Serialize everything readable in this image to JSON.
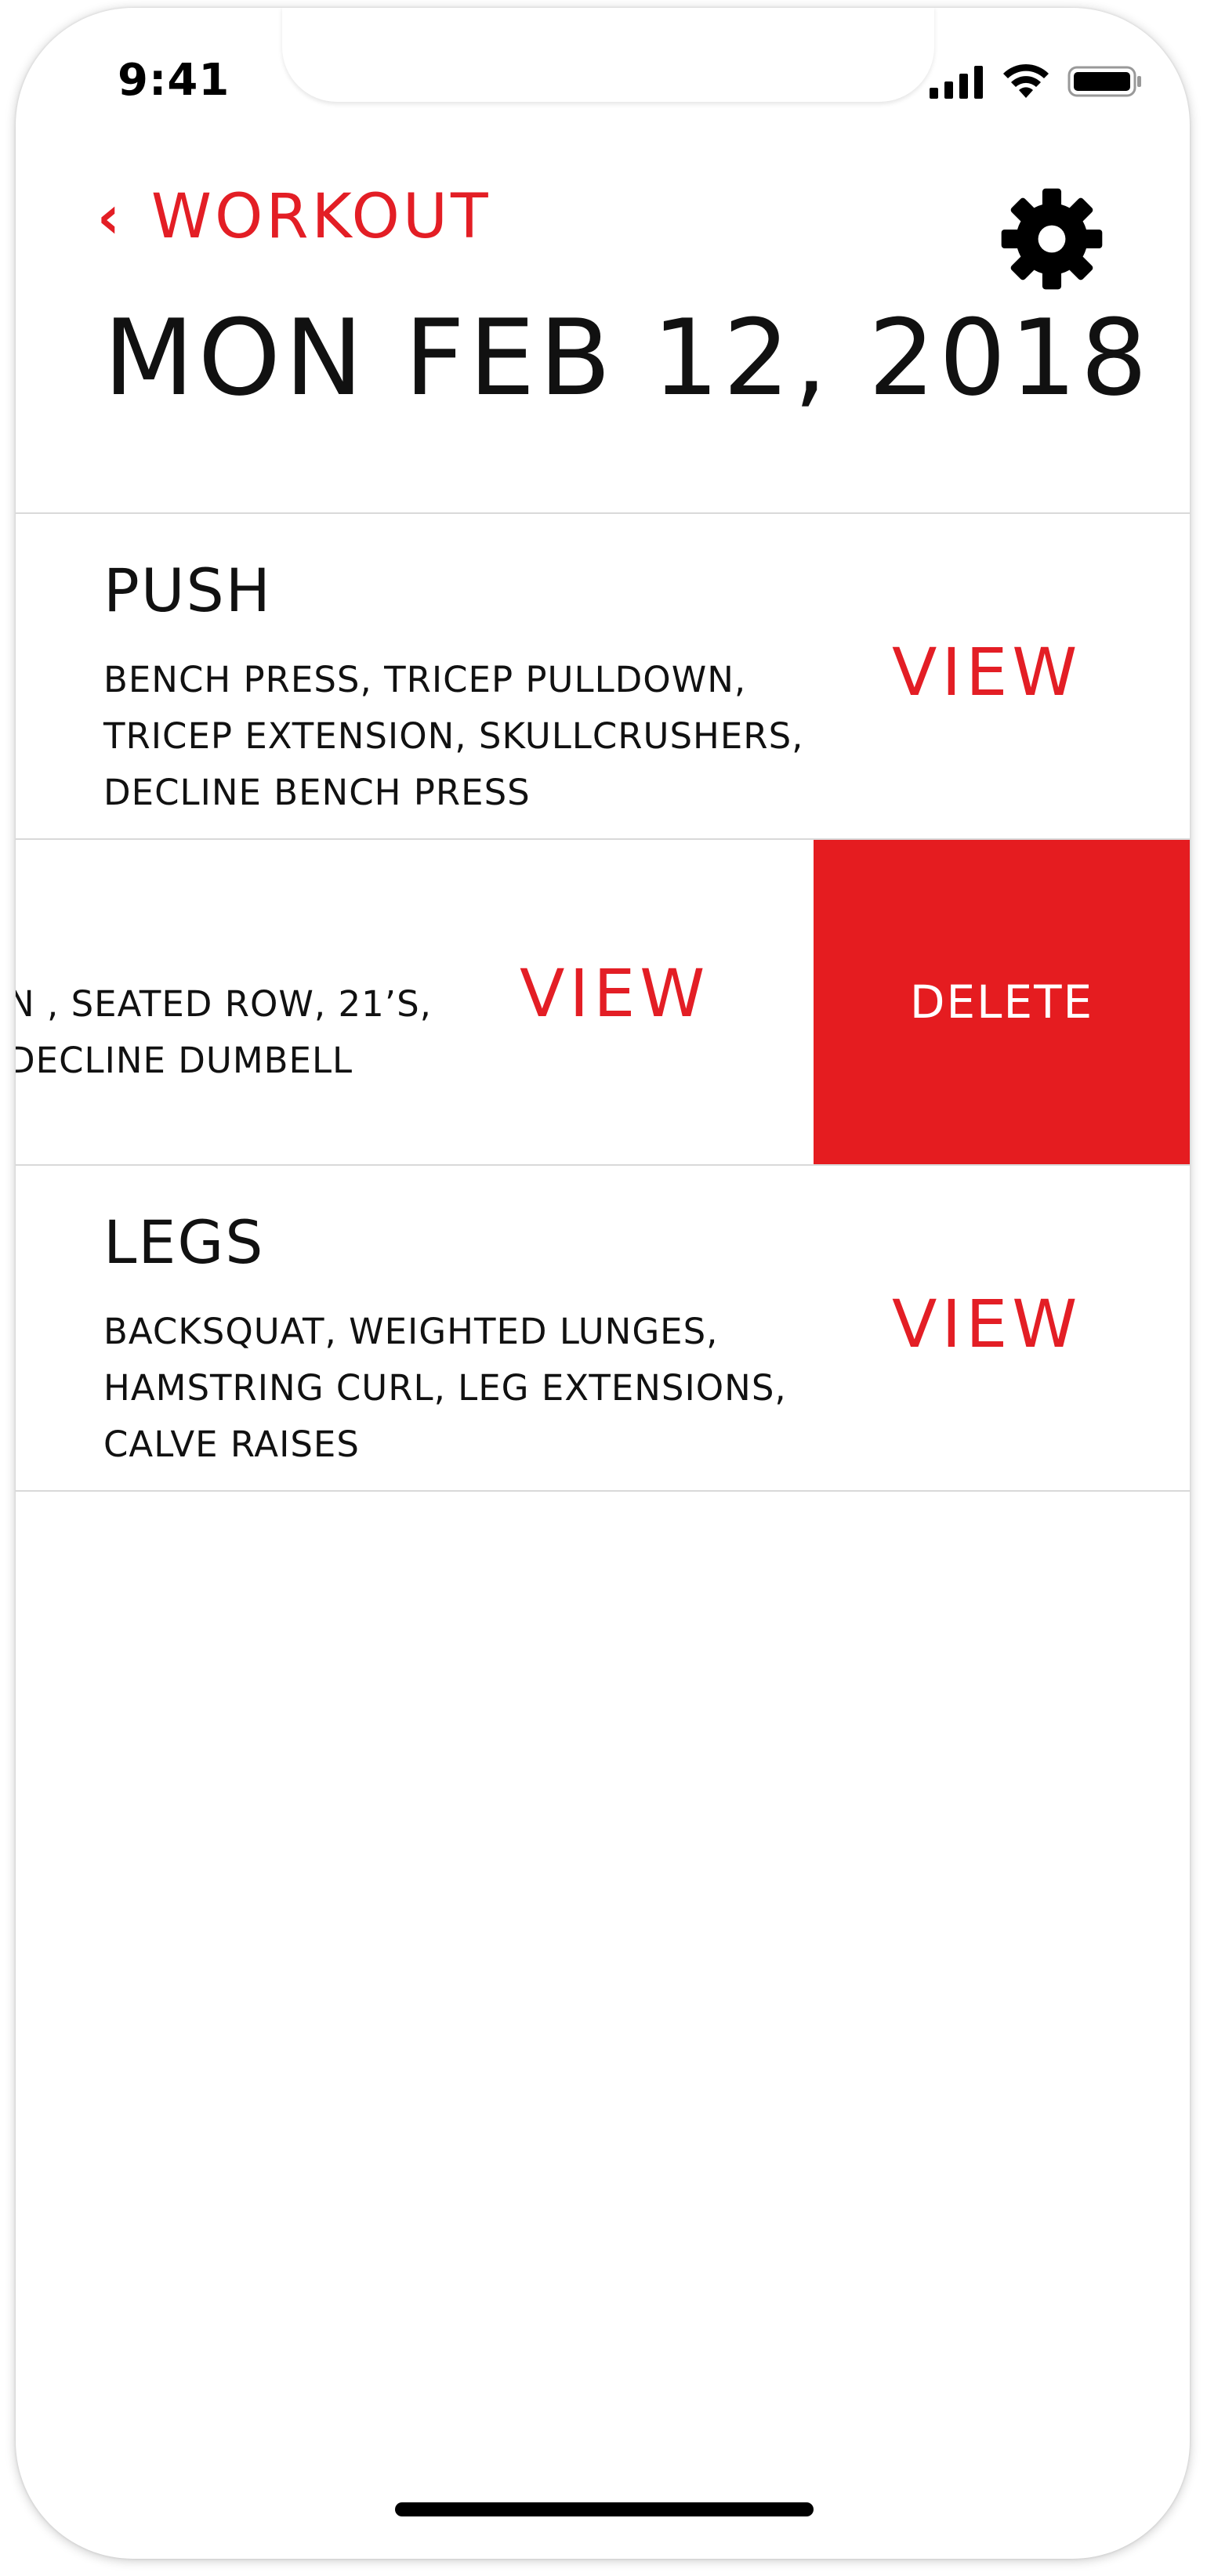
{
  "status_bar": {
    "time": "9:41",
    "signal_icon": "cellular-signal-icon",
    "wifi_icon": "wifi-icon",
    "battery_icon": "battery-icon"
  },
  "header": {
    "back_icon": "chevron-left-icon",
    "back_label": "WORKOUT",
    "settings_icon": "gear-icon",
    "title": "MON FEB 12, 2018"
  },
  "colors": {
    "accent": "#e31e25",
    "delete_bg": "#e51c20",
    "text": "#111111"
  },
  "workouts": [
    {
      "name": "PUSH",
      "exercises_lines": [
        "BENCH PRESS, TRICEP PULLDOWN,",
        "TRICEP EXTENSION, SKULLCRUSHERS,",
        "DECLINE BENCH PRESS"
      ],
      "view_label": "VIEW"
    },
    {
      "name": "",
      "exercises_lines": [
        "N ,  SEATED ROW, 21’S,",
        "  DECLINE DUMBELL"
      ],
      "view_label": "VIEW",
      "delete_label": "DELETE",
      "swiped": true
    },
    {
      "name": "LEGS",
      "exercises_lines": [
        "BACKSQUAT, WEIGHTED LUNGES,",
        "HAMSTRING CURL, LEG EXTENSIONS,",
        "CALVE RAISES"
      ],
      "view_label": "VIEW"
    }
  ]
}
